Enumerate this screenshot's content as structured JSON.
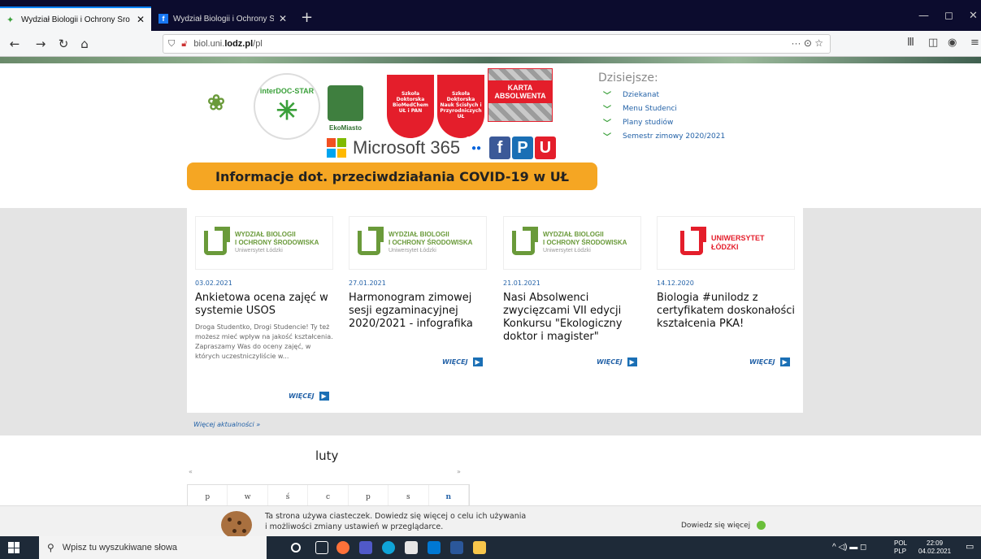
{
  "browser": {
    "tabs": [
      {
        "label": "Wydział Biologii i Ochrony Śro",
        "active": true
      },
      {
        "label": "Wydział Biologii i Ochrony Śro",
        "active": false
      }
    ],
    "new_tab": "+",
    "close": "✕",
    "url_prefix": "biol.uni.",
    "url_domain": "lodz.pl",
    "url_path": "/pl",
    "url_actions": "··· ⊙ ☆"
  },
  "header": {
    "logo_interdoc": "interDOC-STAR",
    "logo_ekomiasto": "EkoMiasto",
    "shield1": "Szkoła Doktorska BioMedChem UŁ i PAN",
    "shield2": "Szkoła Doktorska Nauk Ścisłych i Przyrodniczych UŁ",
    "karta": "KARTA ABSOLWENTA",
    "ms365": "Microsoft 365",
    "covid_banner": "Informacje dot. przeciwdziałania COVID-19 w UŁ"
  },
  "today": {
    "title": "Dzisiejsze:",
    "items": [
      "Dziekanat",
      "Menu Studenci",
      "Plany studiów",
      "Semestr zimowy 2020/2021"
    ]
  },
  "news": [
    {
      "logo_line1": "WYDZIAŁ BIOLOGII",
      "logo_line2": "I OCHRONY ŚRODOWISKA",
      "logo_line3": "Uniwersytet Łódzki",
      "date": "03.02.2021",
      "title": "Ankietowa ocena zajęć w systemie USOS",
      "desc": "Droga Studentko, Drogi Studencie! Ty też możesz mieć wpływ na jakość kształcenia. Zapraszamy Was do oceny zajęć, w których uczestniczyliście w...",
      "more": "WIĘCEJ"
    },
    {
      "logo_line1": "WYDZIAŁ BIOLOGII",
      "logo_line2": "I OCHRONY ŚRODOWISKA",
      "logo_line3": "Uniwersytet Łódzki",
      "date": "27.01.2021",
      "title": "Harmonogram zimowej sesji egzaminacyjnej 2020/2021 - infografika",
      "more": "WIĘCEJ"
    },
    {
      "logo_line1": "WYDZIAŁ BIOLOGII",
      "logo_line2": "I OCHRONY ŚRODOWISKA",
      "logo_line3": "Uniwersytet Łódzki",
      "date": "21.01.2021",
      "title": "Nasi Absolwenci zwycięzcami VII edycji Konkursu \"Ekologiczny doktor i magister\"",
      "more": "WIĘCEJ"
    },
    {
      "logo_line1": "UNIWERSYTET",
      "logo_line2": "ŁÓDZKI",
      "date": "14.12.2020",
      "title": "Biologia #unilodz z certyfikatem doskonałości kształcenia PKA!",
      "more": "WIĘCEJ"
    }
  ],
  "all_news": "Więcej aktualności »",
  "calendar": {
    "month": "luty",
    "prev": "«",
    "next": "»",
    "days": [
      "p",
      "w",
      "ś",
      "c",
      "p",
      "s",
      "n"
    ]
  },
  "cookie": {
    "line1": "Ta strona używa ciasteczek. Dowiedz się więcej o celu ich używania",
    "line2": "i możliwości zmiany ustawień w przeglądarce.",
    "link": "Dowiedz się więcej"
  },
  "taskbar": {
    "search_placeholder": "Wpisz tu wyszukiwane słowa",
    "lang1": "POL",
    "lang2": "PLP",
    "time": "22:09",
    "date": "04.02.2021"
  },
  "colors": {
    "accent_blue": "#2563a8",
    "green": "#6a9a3a",
    "ul_red": "#e41e2b",
    "covid_orange": "#f5a623"
  }
}
